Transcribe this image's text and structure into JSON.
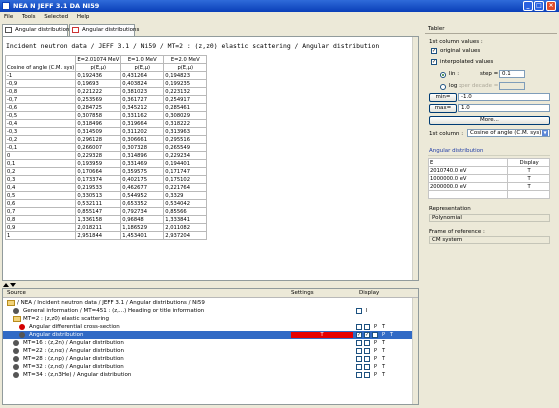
{
  "window": {
    "title": "NEA N JEFF 3.1 DA NI59"
  },
  "menu": [
    "File",
    "Tools",
    "Selected",
    "Help"
  ],
  "tabs": [
    {
      "label": "Angular distributions"
    },
    {
      "label": "Angular distributions"
    }
  ],
  "plot_title": "Incident neutron data / JEFF 3.1 / Ni59 / MT=2 : (z,z0) elastic scattering / Angular distribution",
  "table": {
    "row_header": "Cosine of angle (C.M. sys)",
    "energies": [
      "E=2.01074 MeV",
      "E=1.0 MeV",
      "E=2.0 MeV"
    ],
    "col_labels": [
      "p(E,μ)",
      "p(E,μ)",
      "p(E,μ)"
    ],
    "rows": [
      [
        "-1",
        "0,192436",
        "0,431264",
        "0,194823"
      ],
      [
        "-0,9",
        "0,19693",
        "0,403824",
        "0,199235"
      ],
      [
        "-0,8",
        "0,221222",
        "0,381023",
        "0,223132"
      ],
      [
        "-0,7",
        "0,253569",
        "0,361727",
        "0,254917"
      ],
      [
        "-0,6",
        "0,284725",
        "0,345212",
        "0,285461"
      ],
      [
        "-0,5",
        "0,307858",
        "0,331162",
        "0,308029"
      ],
      [
        "-0,4",
        "0,318496",
        "0,319664",
        "0,318222"
      ],
      [
        "-0,3",
        "0,314509",
        "0,311202",
        "0,313963"
      ],
      [
        "-0,2",
        "0,296128",
        "0,306661",
        "0,295516"
      ],
      [
        "-0,1",
        "0,266007",
        "0,307328",
        "0,265549"
      ],
      [
        "0",
        "0,229328",
        "0,314896",
        "0,229234"
      ],
      [
        "0,1",
        "0,193959",
        "0,331469",
        "0,194401"
      ],
      [
        "0,2",
        "0,170664",
        "0,359575",
        "0,171747"
      ],
      [
        "0,3",
        "0,173374",
        "0,402175",
        "0,175102"
      ],
      [
        "0,4",
        "0,219533",
        "0,462677",
        "0,221764"
      ],
      [
        "0,5",
        "0,330513",
        "0,544952",
        "0,3329"
      ],
      [
        "0,6",
        "0,532111",
        "0,653352",
        "0,534042"
      ],
      [
        "0,7",
        "0,855147",
        "0,792734",
        "0,85566"
      ],
      [
        "0,8",
        "1,336158",
        "0,96848",
        "1,333841"
      ],
      [
        "0,9",
        "2,018211",
        "1,186529",
        "2,011082"
      ],
      [
        "1",
        "2,951844",
        "1,453401",
        "2,937204"
      ]
    ]
  },
  "tree": {
    "headers": {
      "source": "Source",
      "settings": "Settings",
      "display": "Display"
    },
    "items": [
      {
        "label": "/ NEA / Incident neutron data / JEFF 3.1 / Angular distributions / Ni59",
        "cb": [],
        "cbl": []
      },
      {
        "label": "General information / MT=451 : (z,...) Heading or title information",
        "cb": [
          ""
        ],
        "cbl": [
          "I"
        ]
      },
      {
        "label": "MT=2 : (z,z0) elastic scattering",
        "cb": [],
        "cbl": []
      },
      {
        "label": "Angular differential cross-section",
        "cb": [
          "",
          ""
        ],
        "cbl": [
          "P",
          "T"
        ]
      },
      {
        "label": "Angular distribution",
        "setting": "T",
        "cb": [
          "✓",
          "✓",
          ""
        ],
        "cbl": [
          "P",
          "T"
        ],
        "selected": true
      },
      {
        "label": "MT=16 : (z,2n) / Angular distribution",
        "cb": [
          "",
          ""
        ],
        "cbl": [
          "P",
          "T"
        ]
      },
      {
        "label": "MT=22 : (z,nα) / Angular distribution",
        "cb": [
          "",
          ""
        ],
        "cbl": [
          "P",
          "T"
        ]
      },
      {
        "label": "MT=28 : (z,np) / Angular distribution",
        "cb": [
          "",
          ""
        ],
        "cbl": [
          "P",
          "T"
        ]
      },
      {
        "label": "MT=32 : (z,nd) / Angular distribution",
        "cb": [
          "",
          ""
        ],
        "cbl": [
          "P",
          "T"
        ]
      },
      {
        "label": "MT=34 : (z,n3He) / Angular distribution",
        "cb": [
          "",
          ""
        ],
        "cbl": [
          "P",
          "T"
        ]
      }
    ]
  },
  "tabler": {
    "title": "Tabler",
    "first_col_values": "1st column values :",
    "original_values": "original values",
    "interpolated_values": "interpolated values",
    "lin": "lin :",
    "step_label": "step =",
    "step_value": "0.1",
    "log": "log :",
    "per_decade": "per decade =",
    "min_label": "min=",
    "min_value": "-1.0",
    "max_label": "max=",
    "max_value": "1.0",
    "more": "More...",
    "first_col_label": "1st column :",
    "first_col_select": "Cosine of angle (C.M. sys)",
    "angular_title": "Angular distribution",
    "energy_headers": [
      "E",
      "Display"
    ],
    "energies": [
      [
        "2010740.0 eV",
        "T"
      ],
      [
        "1000000.0 eV",
        "T"
      ],
      [
        "2000000.0 eV",
        "T"
      ]
    ],
    "representation_label": "Representation",
    "representation_value": "Polynomial",
    "frame_label": "Frame of reference :",
    "frame_value": "CM system"
  }
}
